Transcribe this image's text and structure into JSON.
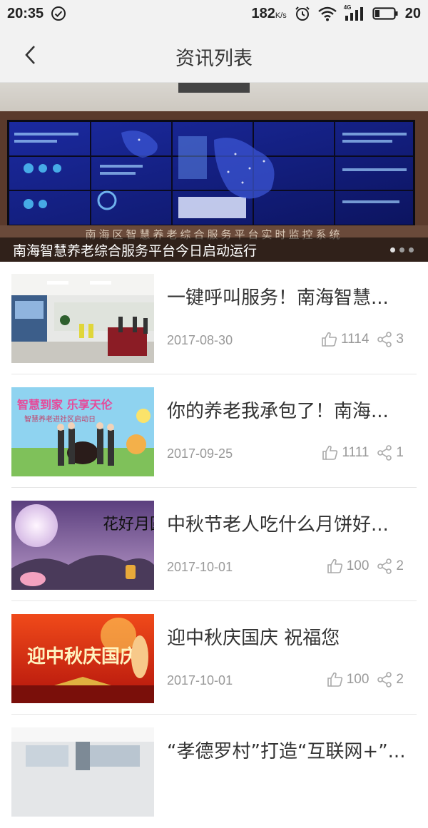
{
  "status_bar": {
    "time": "20:35",
    "speed_value": "182",
    "speed_unit": "K/s",
    "network_type": "4G",
    "battery": "20"
  },
  "header": {
    "title": "资讯列表"
  },
  "banner": {
    "caption": "南海智慧养老综合服务平台今日启动运行",
    "wall_text": "南海区智慧养老综合服务平台实时监控系统",
    "slide_count": 3,
    "active_index": 1
  },
  "news": [
    {
      "title": "一键呼叫服务！南海智慧...",
      "date": "2017-08-30",
      "likes": "1114",
      "shares": "3"
    },
    {
      "title": "你的养老我承包了！南海...",
      "date": "2017-09-25",
      "likes": "1111",
      "shares": "1"
    },
    {
      "title": "中秋节老人吃什么月饼好...",
      "date": "2017-10-01",
      "likes": "100",
      "shares": "2"
    },
    {
      "title": "迎中秋庆国庆 祝福您",
      "date": "2017-10-01",
      "likes": "100",
      "shares": "2"
    },
    {
      "title": "“孝德罗村”打造“互联网+”..."
    }
  ],
  "thumb_text": {
    "poster_line1": "智慧到家 乐享天伦",
    "poster_line2": "智慧养老进社区启动日",
    "moon_text": "花好月圆",
    "festival_text": "迎中秋庆国庆"
  }
}
